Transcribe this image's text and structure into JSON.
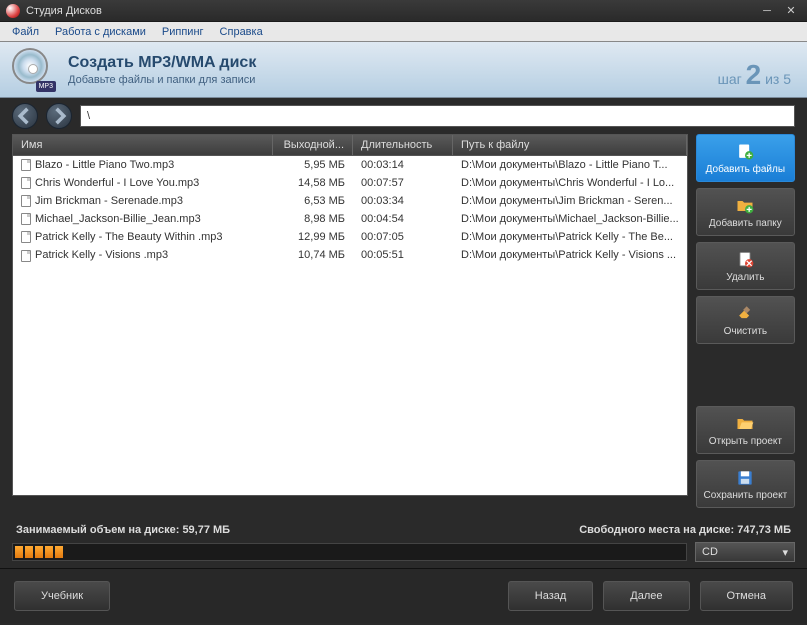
{
  "window": {
    "title": "Студия Дисков"
  },
  "menu": {
    "file": "Файл",
    "discs": "Работа с дисками",
    "ripping": "Риппинг",
    "help": "Справка"
  },
  "banner": {
    "title": "Создать MP3/WMA диск",
    "subtitle": "Добавьте файлы и папки для записи",
    "tag": "MP3",
    "step_label": "шаг",
    "step_num": "2",
    "step_of": "из 5"
  },
  "path": {
    "value": "\\"
  },
  "columns": {
    "name": "Имя",
    "size": "Выходной...",
    "duration": "Длительность",
    "path": "Путь к файлу"
  },
  "files": [
    {
      "name": "Blazo - Little Piano Two.mp3",
      "size": "5,95 МБ",
      "duration": "00:03:14",
      "path": "D:\\Мои документы\\Blazo - Little Piano T..."
    },
    {
      "name": "Chris Wonderful - I Love You.mp3",
      "size": "14,58 МБ",
      "duration": "00:07:57",
      "path": "D:\\Мои документы\\Chris Wonderful - I Lo..."
    },
    {
      "name": "Jim Brickman - Serenade.mp3",
      "size": "6,53 МБ",
      "duration": "00:03:34",
      "path": "D:\\Мои документы\\Jim Brickman - Seren..."
    },
    {
      "name": "Michael_Jackson-Billie_Jean.mp3",
      "size": "8,98 МБ",
      "duration": "00:04:54",
      "path": "D:\\Мои документы\\Michael_Jackson-Billie..."
    },
    {
      "name": "Patrick Kelly - The Beauty Within .mp3",
      "size": "12,99 МБ",
      "duration": "00:07:05",
      "path": "D:\\Мои документы\\Patrick Kelly - The Be..."
    },
    {
      "name": "Patrick Kelly - Visions .mp3",
      "size": "10,74 МБ",
      "duration": "00:05:51",
      "path": "D:\\Мои документы\\Patrick Kelly - Visions ..."
    }
  ],
  "sidebar": {
    "add_files": "Добавить файлы",
    "add_folder": "Добавить папку",
    "delete": "Удалить",
    "clear": "Очистить",
    "open_project": "Открыть проект",
    "save_project": "Сохранить проект"
  },
  "status": {
    "used_label": "Занимаемый объем на диске:",
    "used_value": "59,77 МБ",
    "free_label": "Свободного места на диске:",
    "free_value": "747,73 МБ"
  },
  "disc_selector": "CD",
  "footer": {
    "tutorial": "Учебник",
    "back": "Назад",
    "next": "Далее",
    "cancel": "Отмена"
  }
}
